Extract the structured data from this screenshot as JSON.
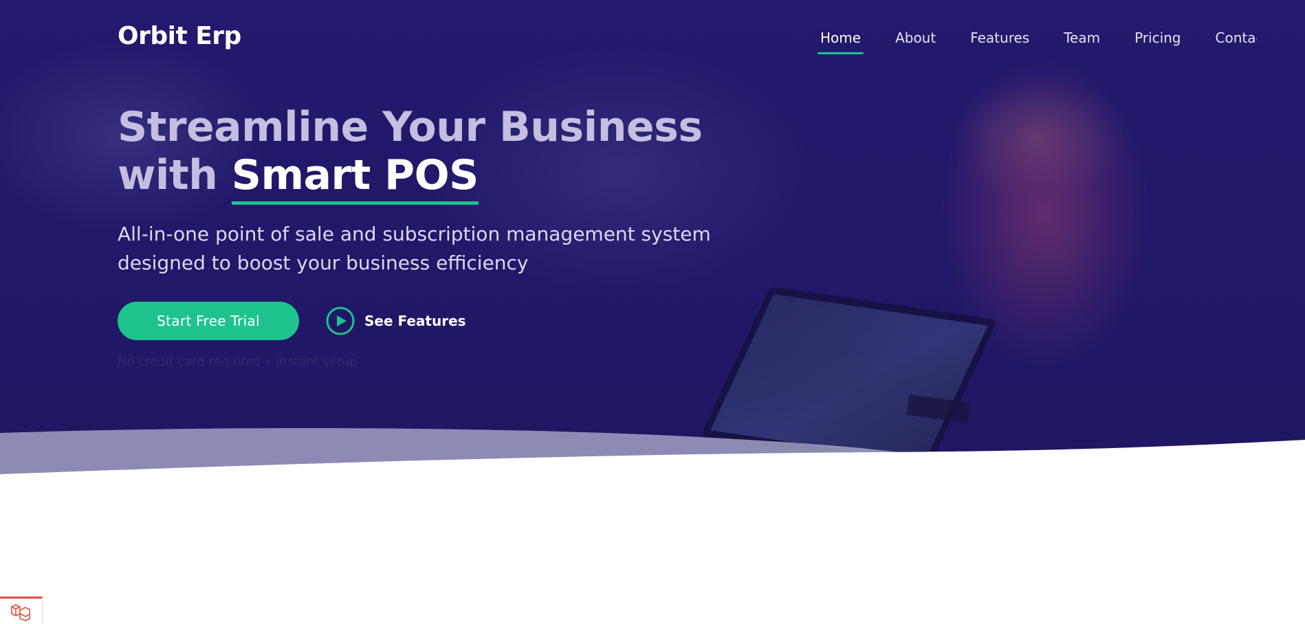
{
  "brand": {
    "name": "Orbit Erp"
  },
  "nav": {
    "items": [
      {
        "label": "Home",
        "active": true
      },
      {
        "label": "About",
        "active": false
      },
      {
        "label": "Features",
        "active": false
      },
      {
        "label": "Team",
        "active": false
      },
      {
        "label": "Pricing",
        "active": false
      },
      {
        "label": "Contact",
        "active": false
      }
    ]
  },
  "hero": {
    "headline_line1": "Streamline Your Business",
    "headline_line2_prefix": "with ",
    "headline_accent": "Smart POS",
    "subtitle": "All-in-one point of sale and subscription management system designed to boost your business efficiency",
    "primary_cta": "Start Free Trial",
    "secondary_cta": "See Features",
    "note": "No credit card required • Instant setup"
  },
  "icons": {
    "play": "play-circle-icon",
    "debug": "laravel-icon"
  },
  "colors": {
    "hero_bg": "#21186a",
    "accent": "#1ec38d",
    "headline_muted": "#c2bfe0",
    "debug_bar": "#e74c3c"
  }
}
